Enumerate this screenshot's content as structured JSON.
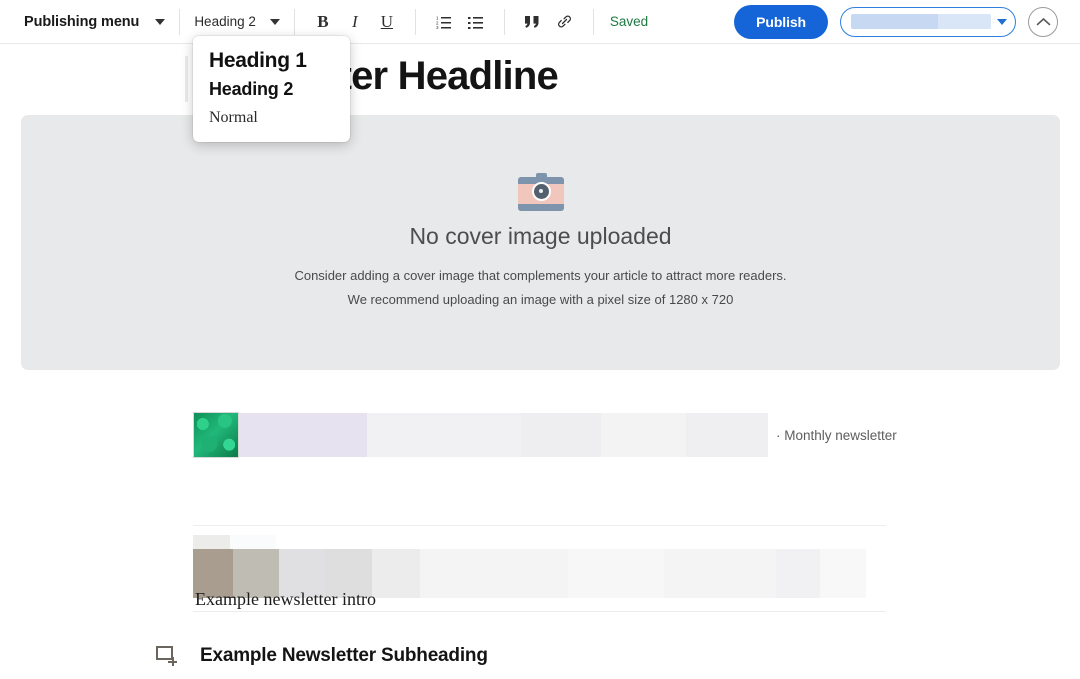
{
  "toolbar": {
    "publishing_menu_label": "Publishing menu",
    "style_selected": "Heading 2",
    "bold_label": "B",
    "italic_label": "I",
    "underline_label": "U",
    "ordered_list_icon": "ordered-list-icon",
    "bullet_list_icon": "bullet-list-icon",
    "quote_icon": "quote-icon",
    "link_icon": "link-icon",
    "save_status": "Saved",
    "publish_label": "Publish",
    "collapse_icon": "chevron-up-icon",
    "accent_color": "#1565d8",
    "saved_color": "#1e7a42"
  },
  "style_dropdown": {
    "options": [
      {
        "label": "Heading 1"
      },
      {
        "label": "Heading 2"
      },
      {
        "label": "Normal"
      }
    ]
  },
  "document": {
    "headline": "Newsletter Headline",
    "cover": {
      "icon": "camera-icon",
      "title": "No cover image uploaded",
      "line1": "Consider adding a cover image that complements your article to attract more readers.",
      "line2": "We recommend uploading an image with a pixel size of 1280 x 720"
    },
    "embed_block_caption": "· Monthly newsletter",
    "intro_text": "Example newsletter intro",
    "subheading_text": "Example Newsletter Subheading",
    "add_block_icon": "add-block-icon"
  }
}
